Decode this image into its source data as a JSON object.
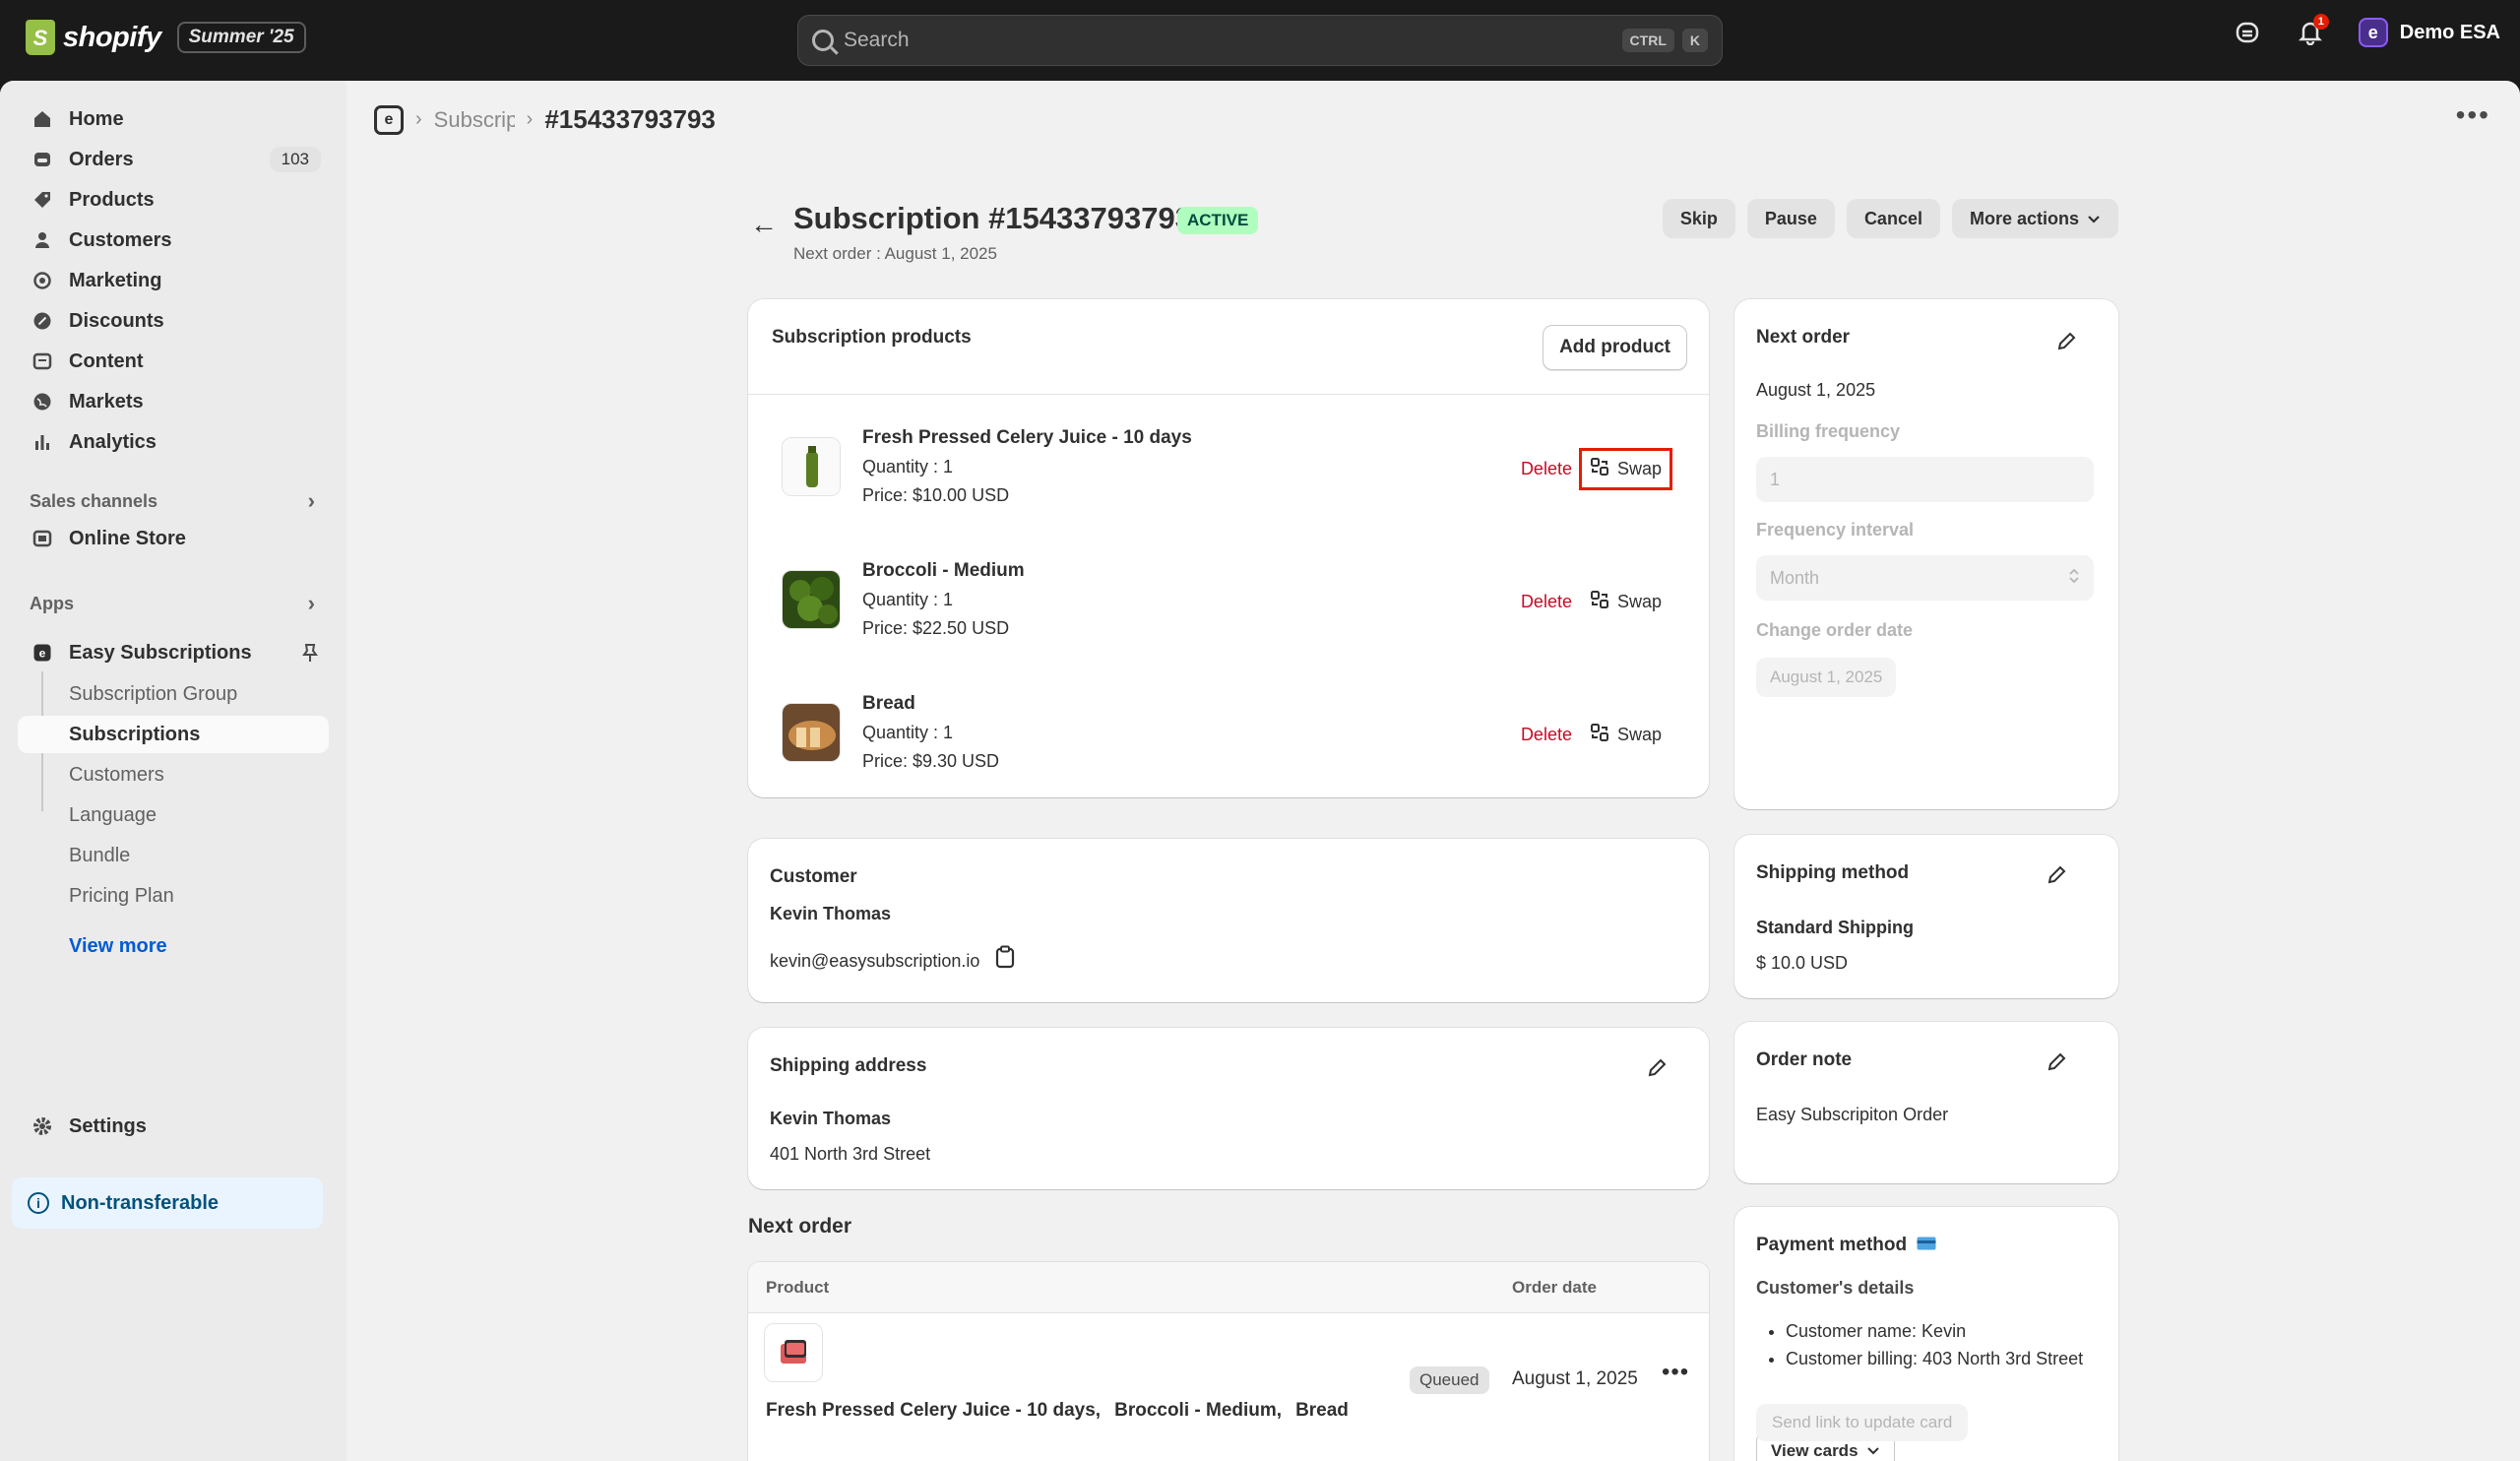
{
  "topbar": {
    "brand": "shopify",
    "badge": "Summer '25",
    "search_placeholder": "Search",
    "shortcut_keys": [
      "CTRL",
      "K"
    ],
    "notification_count": "1",
    "store_name": "Demo ESA",
    "store_initial": "e"
  },
  "sidebar": {
    "nav": [
      {
        "label": "Home",
        "icon": "home-icon"
      },
      {
        "label": "Orders",
        "icon": "orders-icon",
        "count": "103"
      },
      {
        "label": "Products",
        "icon": "tag-icon"
      },
      {
        "label": "Customers",
        "icon": "person-icon"
      },
      {
        "label": "Marketing",
        "icon": "target-icon"
      },
      {
        "label": "Discounts",
        "icon": "discount-icon"
      },
      {
        "label": "Content",
        "icon": "content-icon"
      },
      {
        "label": "Markets",
        "icon": "globe-icon"
      },
      {
        "label": "Analytics",
        "icon": "chart-icon"
      }
    ],
    "sales_channels_label": "Sales channels",
    "online_store_label": "Online Store",
    "apps_label": "Apps",
    "app_name": "Easy Subscriptions",
    "app_items": [
      "Subscription Group",
      "Subscriptions",
      "Customers",
      "Language",
      "Bundle",
      "Pricing Plan"
    ],
    "active_app_item": "Subscriptions",
    "view_more": "View more",
    "settings_label": "Settings",
    "non_transferable": "Non-transferable"
  },
  "breadcrumb": {
    "parent": "Subscriptions",
    "current": "#15433793793"
  },
  "page": {
    "title": "Subscription #15433793793",
    "status": "ACTIVE",
    "subtitle": "Next order : August 1, 2025",
    "actions": [
      "Skip",
      "Pause",
      "Cancel",
      "More actions"
    ]
  },
  "products_card": {
    "title": "Subscription products",
    "add_button": "Add product",
    "delete_label": "Delete",
    "swap_label": "Swap",
    "items": [
      {
        "name": "Fresh Pressed Celery Juice - 10 days",
        "quantity": "Quantity : 1",
        "price": "Price: $10.00 USD",
        "thumb": "celery-juice-thumbnail"
      },
      {
        "name": "Broccoli - Medium",
        "quantity": "Quantity : 1",
        "price": "Price: $22.50 USD",
        "thumb": "broccoli-thumbnail"
      },
      {
        "name": "Bread",
        "quantity": "Quantity : 1",
        "price": "Price: $9.30 USD",
        "thumb": "bread-thumbnail"
      }
    ]
  },
  "customer_card": {
    "title": "Customer",
    "name": "Kevin Thomas",
    "email": "kevin@easysubscription.io"
  },
  "shipping_address_card": {
    "title": "Shipping address",
    "name": "Kevin Thomas",
    "address": "401 North 3rd Street"
  },
  "next_order_section": {
    "title": "Next order",
    "col_product": "Product",
    "col_date": "Order date",
    "products": [
      "Fresh Pressed Celery Juice - 10 days,",
      "Broccoli - Medium,",
      "Bread"
    ],
    "status": "Queued",
    "date": "August 1, 2025"
  },
  "next_order_card": {
    "title": "Next order",
    "date": "August 1, 2025",
    "billing_label": "Billing frequency",
    "billing_value": "1",
    "interval_label": "Frequency interval",
    "interval_value": "Month",
    "change_label": "Change order date",
    "change_value": "August 1, 2025"
  },
  "shipping_method_card": {
    "title": "Shipping method",
    "method": "Standard Shipping",
    "price": "$ 10.0 USD"
  },
  "order_note_card": {
    "title": "Order note",
    "note": "Easy Subscripiton Order"
  },
  "payment_card": {
    "title": "Payment method",
    "details_label": "Customer's details",
    "details": [
      "Customer name: Kevin",
      "Customer billing: 403 North 3rd Street"
    ],
    "view_cards": "View cards",
    "send_link": "Send link to update card"
  },
  "colors": {
    "accent_link": "#005bd3",
    "delete": "#c70a24",
    "active_badge_bg": "#affebf",
    "highlight_outline": "#e51c00"
  }
}
